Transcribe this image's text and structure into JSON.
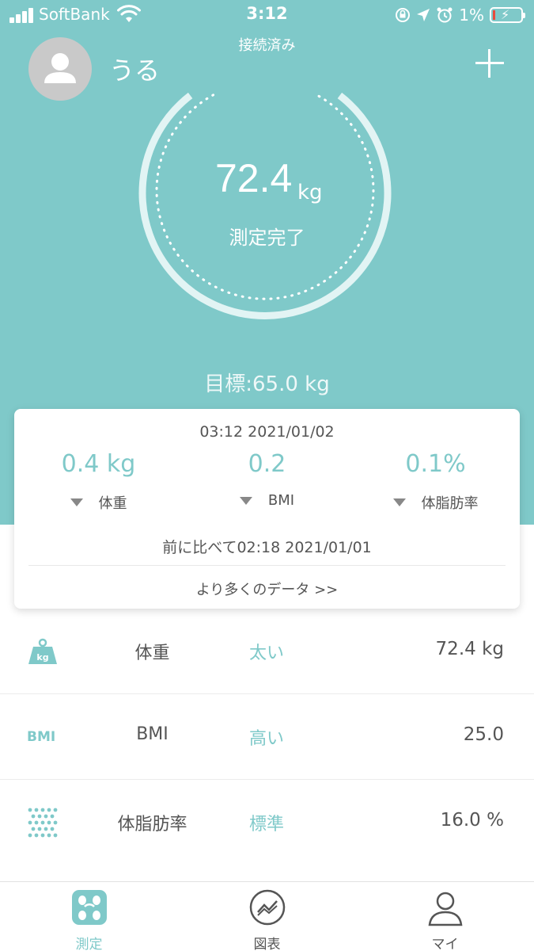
{
  "status_bar": {
    "carrier": "SoftBank",
    "time": "3:12",
    "battery": "1%"
  },
  "header": {
    "connection_status": "接続済み",
    "username": "うる"
  },
  "gauge": {
    "weight_value": "72.4",
    "weight_unit": "kg",
    "status": "測定完了"
  },
  "goal": "目標:65.0 kg",
  "card": {
    "datetime": "03:12 2021/01/02",
    "metrics": [
      {
        "value": "0.4 kg",
        "label": "体重"
      },
      {
        "value": "0.2",
        "label": "BMI"
      },
      {
        "value": "0.1%",
        "label": "体脂肪率"
      }
    ],
    "compare": "前に比べて02:18 2021/01/01",
    "more_link": "より多くのデータ >>"
  },
  "rows": [
    {
      "icon": "weight-kg-icon",
      "icon_text": "kg",
      "name": "体重",
      "status": "太い",
      "value": "72.4 kg"
    },
    {
      "icon": "bmi-icon",
      "icon_text": "BMI",
      "name": "BMI",
      "status": "高い",
      "value": "25.0"
    },
    {
      "icon": "body-fat-dots-icon",
      "name": "体脂肪率",
      "status": "標準",
      "value": "16.0 %"
    }
  ],
  "tabs": [
    {
      "label": "測定",
      "icon": "scale-icon",
      "active": true
    },
    {
      "label": "図表",
      "icon": "chart-icon",
      "active": false
    },
    {
      "label": "マイ",
      "icon": "person-icon",
      "active": false
    }
  ],
  "colors": {
    "accent": "#7fc9c9",
    "hero_background": "#7fc9c9",
    "text": "#555555",
    "battery_low": "#e94b3c"
  }
}
